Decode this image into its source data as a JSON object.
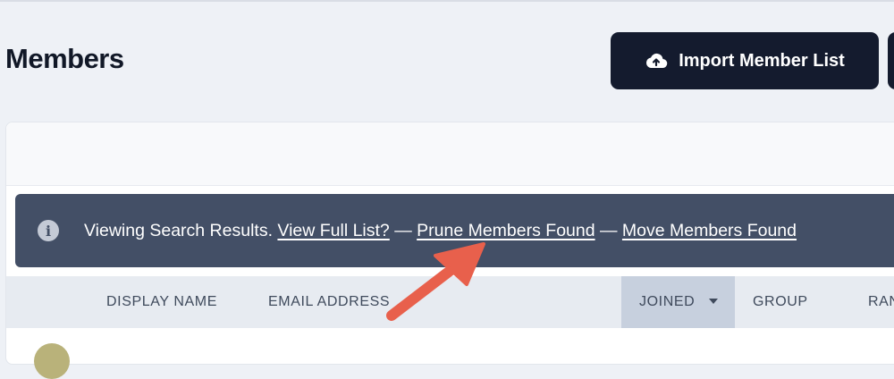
{
  "page": {
    "title": "Members"
  },
  "header": {
    "import_button": {
      "label": "Import Member List",
      "icon": "cloud-upload-icon"
    }
  },
  "banner": {
    "icon": "info-circle-icon",
    "message": "Viewing Search Results.",
    "view_full_list_link": "View Full List?",
    "separator_1": "—",
    "prune_link": "Prune Members Found",
    "separator_2": "—",
    "move_link": "Move Members Found",
    "background_color": "#434f66"
  },
  "table": {
    "columns": [
      {
        "label": "DISPLAY NAME"
      },
      {
        "label": "EMAIL ADDRESS"
      },
      {
        "label": "JOINED",
        "sorted": true,
        "sort_direction": "desc"
      },
      {
        "label": "GROUP"
      },
      {
        "label": "RAN"
      }
    ]
  },
  "annotation": {
    "type": "arrow",
    "color": "#e8604c",
    "points_to": "prune_link"
  },
  "colors": {
    "primary_button": "#141b2e",
    "page_background": "#eef1f6",
    "sorted_column": "#c7d0de"
  }
}
